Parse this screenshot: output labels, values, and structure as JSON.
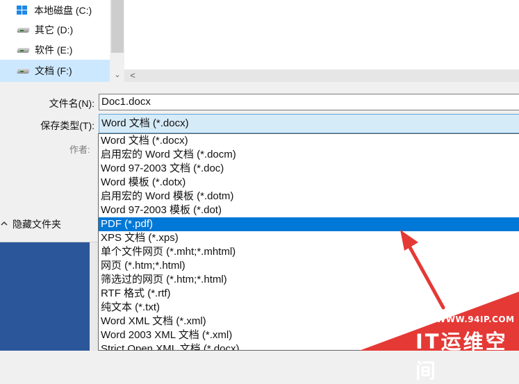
{
  "nav": {
    "drives": [
      {
        "label": "本地磁盘 (C:)",
        "icon": "windows-drive-icon"
      },
      {
        "label": "其它 (D:)",
        "icon": "drive-icon"
      },
      {
        "label": "软件 (E:)",
        "icon": "drive-icon"
      },
      {
        "label": "文档 (F:)",
        "icon": "drive-icon",
        "selected": true
      }
    ],
    "scroll_down": "⌄",
    "scroll_left": "<"
  },
  "form": {
    "filename_label": "文件名(N):",
    "filename_value": "Doc1.docx",
    "savetype_label": "保存类型(T):",
    "savetype_value": "Word 文档 (*.docx)",
    "author_label": "作者:",
    "hide_folders_label": "隐藏文件夹",
    "hide_folders_chevron": "^"
  },
  "dropdown": {
    "selected_index": 6,
    "options": [
      "Word 文档 (*.docx)",
      "启用宏的 Word 文档 (*.docm)",
      "Word 97-2003 文档 (*.doc)",
      "Word 模板 (*.dotx)",
      "启用宏的 Word 模板 (*.dotm)",
      "Word 97-2003 模板 (*.dot)",
      "PDF (*.pdf)",
      "XPS 文档 (*.xps)",
      "单个文件网页 (*.mht;*.mhtml)",
      "网页 (*.htm;*.html)",
      "筛选过的网页 (*.htm;*.html)",
      "RTF 格式 (*.rtf)",
      "纯文本 (*.txt)",
      "Word XML 文档 (*.xml)",
      "Word 2003 XML 文档 (*.xml)",
      "Strict Open XML 文档 (*.docx)"
    ]
  },
  "watermark": {
    "url": "WWW.94IP.COM",
    "brand": "IT运维空间"
  },
  "colors": {
    "highlight": "#0078d7",
    "selection_bg": "#cce8ff",
    "arrow": "#e53935",
    "watermark": "#e53935"
  }
}
